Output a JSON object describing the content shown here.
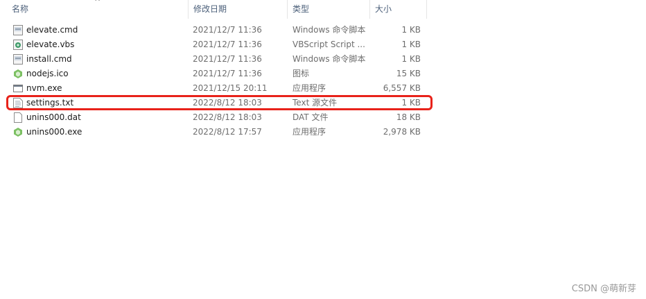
{
  "columns": {
    "name": "名称",
    "date": "修改日期",
    "type": "类型",
    "size": "大小"
  },
  "sort_indicator": "^",
  "files": [
    {
      "name": "elevate.cmd",
      "date": "2021/12/7 11:36",
      "type": "Windows 命令脚本",
      "size": "1 KB",
      "icon": "cmd-script-icon"
    },
    {
      "name": "elevate.vbs",
      "date": "2021/12/7 11:36",
      "type": "VBScript Script ...",
      "size": "1 KB",
      "icon": "vbscript-icon"
    },
    {
      "name": "install.cmd",
      "date": "2021/12/7 11:36",
      "type": "Windows 命令脚本",
      "size": "1 KB",
      "icon": "cmd-script-icon"
    },
    {
      "name": "nodejs.ico",
      "date": "2021/12/7 11:36",
      "type": "图标",
      "size": "15 KB",
      "icon": "nodejs-icon"
    },
    {
      "name": "nvm.exe",
      "date": "2021/12/15 20:11",
      "type": "应用程序",
      "size": "6,557 KB",
      "icon": "exe-icon"
    },
    {
      "name": "settings.txt",
      "date": "2022/8/12 18:03",
      "type": "Text 源文件",
      "size": "1 KB",
      "icon": "text-file-icon"
    },
    {
      "name": "unins000.dat",
      "date": "2022/8/12 18:03",
      "type": "DAT 文件",
      "size": "18 KB",
      "icon": "blank-file-icon"
    },
    {
      "name": "unins000.exe",
      "date": "2022/8/12 17:57",
      "type": "应用程序",
      "size": "2,978 KB",
      "icon": "nodejs-icon"
    }
  ],
  "highlight_color": "#e8221a",
  "watermark": "CSDN @萌新芽"
}
